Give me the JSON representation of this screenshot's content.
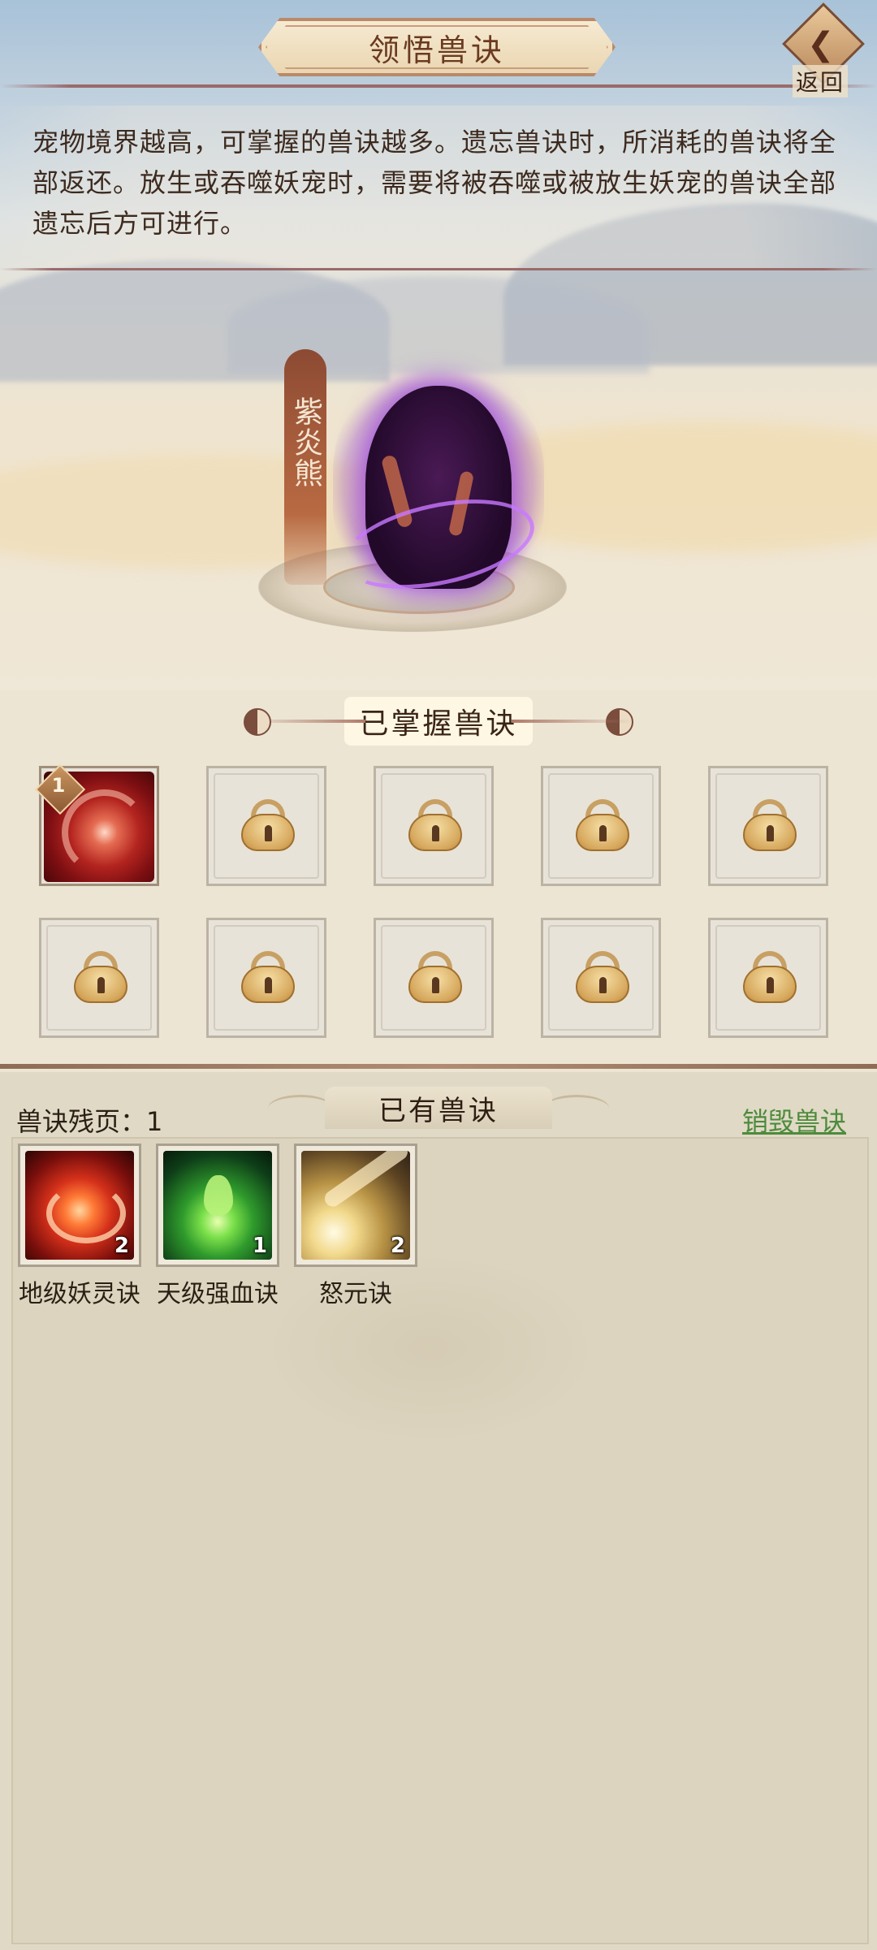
{
  "header": {
    "title": "领悟兽诀",
    "back_label": "返回"
  },
  "description": "宠物境界越高，可掌握的兽诀越多。遗忘兽诀时，所消耗的兽诀将全部返还。放生或吞噬妖宠时，需要将被吞噬或被放生妖宠的兽诀全部遗忘后方可进行。",
  "pet": {
    "name": "紫炎熊",
    "aura_color": "#a23ef0"
  },
  "mastered": {
    "title": "已掌握兽诀",
    "slots": [
      {
        "state": "skill",
        "level": "1",
        "icon": "red-swirl-skill-icon"
      },
      {
        "state": "locked",
        "icon": "lock-icon"
      },
      {
        "state": "locked",
        "icon": "lock-icon"
      },
      {
        "state": "locked",
        "icon": "lock-icon"
      },
      {
        "state": "locked",
        "icon": "lock-icon"
      },
      {
        "state": "locked",
        "icon": "lock-icon"
      },
      {
        "state": "locked",
        "icon": "lock-icon"
      },
      {
        "state": "locked",
        "icon": "lock-icon"
      },
      {
        "state": "locked",
        "icon": "lock-icon"
      },
      {
        "state": "locked",
        "icon": "lock-icon"
      }
    ]
  },
  "owned": {
    "title": "已有兽诀",
    "fragments_label": "兽诀残页：1",
    "destroy_label": "销毁兽诀",
    "destroy_color": "#4d8b3c",
    "items": [
      {
        "name": "地级妖灵诀",
        "count": "2",
        "icon": "fire-swirl-icon"
      },
      {
        "name": "天级强血诀",
        "count": "1",
        "icon": "green-drop-icon"
      },
      {
        "name": "怒元诀",
        "count": "2",
        "icon": "light-burst-icon"
      }
    ]
  }
}
